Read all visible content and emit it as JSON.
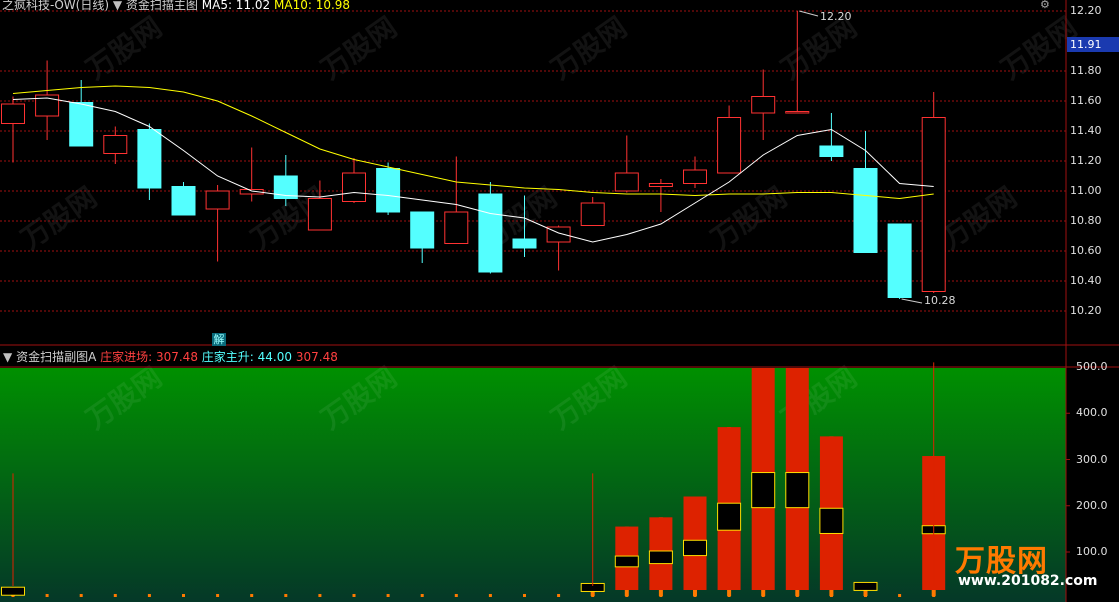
{
  "header_main": {
    "app_title": "之疯科技-OW(日线)",
    "indicator_name": "资金扫描主图",
    "ma5_label": "MA5: 11.02",
    "ma10_label": "MA10: 10.98"
  },
  "header_sub": {
    "indicator_name": "资金扫描副图A",
    "entry_label": "庄家进场: 307.48",
    "rise_label": "庄家主升: 44.00",
    "extra_value": "307.48"
  },
  "marker_label": "解",
  "price_annotations": {
    "high": "12.20",
    "low": "10.28"
  },
  "current_price_tag": "11.91",
  "watermark": "万股网",
  "watermark_url": "www.201082.com",
  "colors": {
    "up": "#ff3232",
    "down": "#54ffff",
    "ma5": "#ffffff",
    "ma10": "#ffff00",
    "sub_bar": "#dd2200",
    "sub_body": "#ffdd00",
    "gradient_top": "#009000",
    "gradient_bottom": "#053828"
  },
  "chart_data": [
    {
      "type": "candlestick",
      "title": "资金扫描主图",
      "ylim": [
        10.1,
        12.3
      ],
      "yticks": [
        "12.20",
        "11.91",
        "11.80",
        "11.60",
        "11.40",
        "11.20",
        "11.00",
        "10.80",
        "10.60",
        "10.40",
        "10.20"
      ],
      "candles": [
        {
          "o": 11.45,
          "c": 11.58,
          "h": 11.63,
          "l": 11.19
        },
        {
          "o": 11.5,
          "c": 11.64,
          "h": 11.87,
          "l": 11.34
        },
        {
          "o": 11.59,
          "c": 11.3,
          "h": 11.74,
          "l": 11.3
        },
        {
          "o": 11.25,
          "c": 11.37,
          "h": 11.43,
          "l": 11.18
        },
        {
          "o": 11.41,
          "c": 11.02,
          "h": 11.45,
          "l": 10.94
        },
        {
          "o": 11.03,
          "c": 10.84,
          "h": 11.06,
          "l": 10.84
        },
        {
          "o": 10.88,
          "c": 11.0,
          "h": 11.04,
          "l": 10.53
        },
        {
          "o": 10.98,
          "c": 11.01,
          "h": 11.29,
          "l": 10.93
        },
        {
          "o": 11.1,
          "c": 10.95,
          "h": 11.24,
          "l": 10.9
        },
        {
          "o": 10.74,
          "c": 10.95,
          "h": 11.07,
          "l": 10.74
        },
        {
          "o": 10.93,
          "c": 11.12,
          "h": 11.22,
          "l": 10.92
        },
        {
          "o": 11.15,
          "c": 10.86,
          "h": 11.19,
          "l": 10.84
        },
        {
          "o": 10.86,
          "c": 10.62,
          "h": 10.86,
          "l": 10.52
        },
        {
          "o": 10.65,
          "c": 10.86,
          "h": 11.23,
          "l": 10.65
        },
        {
          "o": 10.98,
          "c": 10.46,
          "h": 11.06,
          "l": 10.45
        },
        {
          "o": 10.68,
          "c": 10.62,
          "h": 10.97,
          "l": 10.56
        },
        {
          "o": 10.66,
          "c": 10.76,
          "h": 10.77,
          "l": 10.47
        },
        {
          "o": 10.77,
          "c": 10.92,
          "h": 10.96,
          "l": 10.77
        },
        {
          "o": 11.0,
          "c": 11.12,
          "h": 11.37,
          "l": 10.99
        },
        {
          "o": 11.03,
          "c": 11.05,
          "h": 11.08,
          "l": 10.86
        },
        {
          "o": 11.05,
          "c": 11.14,
          "h": 11.23,
          "l": 11.02
        },
        {
          "o": 11.12,
          "c": 11.49,
          "h": 11.57,
          "l": 11.12
        },
        {
          "o": 11.52,
          "c": 11.63,
          "h": 11.81,
          "l": 11.34
        },
        {
          "o": 11.53,
          "c": 11.53,
          "h": 12.2,
          "l": 11.53
        },
        {
          "o": 11.3,
          "c": 11.23,
          "h": 11.52,
          "l": 11.2
        },
        {
          "o": 11.15,
          "c": 10.59,
          "h": 11.4,
          "l": 10.59
        },
        {
          "o": 10.78,
          "c": 10.29,
          "h": 10.78,
          "l": 10.28
        },
        {
          "o": 10.33,
          "c": 11.49,
          "h": 11.66,
          "l": 10.32
        }
      ],
      "ma5": [
        11.61,
        11.62,
        11.58,
        11.53,
        11.43,
        11.27,
        11.1,
        11.0,
        10.97,
        10.96,
        10.99,
        10.97,
        10.94,
        10.91,
        10.85,
        10.82,
        10.72,
        10.66,
        10.71,
        10.78,
        10.92,
        11.06,
        11.24,
        11.37,
        11.41,
        11.27,
        11.05,
        11.03
      ],
      "ma10": [
        11.65,
        11.67,
        11.69,
        11.7,
        11.69,
        11.66,
        11.6,
        11.5,
        11.39,
        11.28,
        11.21,
        11.16,
        11.11,
        11.06,
        11.04,
        11.02,
        11.01,
        10.99,
        10.98,
        10.98,
        10.97,
        10.98,
        10.98,
        10.99,
        10.99,
        10.97,
        10.95,
        10.98
      ],
      "ma_labels": {
        "MA5": 11.02,
        "MA10": 10.98
      }
    },
    {
      "type": "bar",
      "title": "资金扫描副图A",
      "ylim": [
        -15,
        510
      ],
      "yticks": [
        "500.0",
        "400.0",
        "300.0",
        "200.0",
        "100.0"
      ],
      "series": [
        {
          "name": "庄家进场",
          "values": [
            12,
            0,
            0,
            0,
            0,
            0,
            0,
            0,
            0,
            0,
            0,
            0,
            0,
            0,
            0,
            0,
            0,
            30,
            155,
            175,
            220,
            370,
            510,
            510,
            350,
            35,
            0,
            307.48
          ]
        },
        {
          "name": "庄家主升",
          "values": [
            10,
            0,
            0,
            0,
            0,
            0,
            0,
            0,
            0,
            0,
            0,
            0,
            0,
            0,
            0,
            0,
            0,
            12,
            60,
            70,
            85,
            150,
            195,
            195,
            140,
            28,
            0,
            44
          ]
        }
      ],
      "spikes": [
        {
          "index": 0,
          "value": 270
        },
        {
          "index": 17,
          "value": 270
        },
        {
          "index": 27,
          "value": 510
        }
      ]
    }
  ]
}
